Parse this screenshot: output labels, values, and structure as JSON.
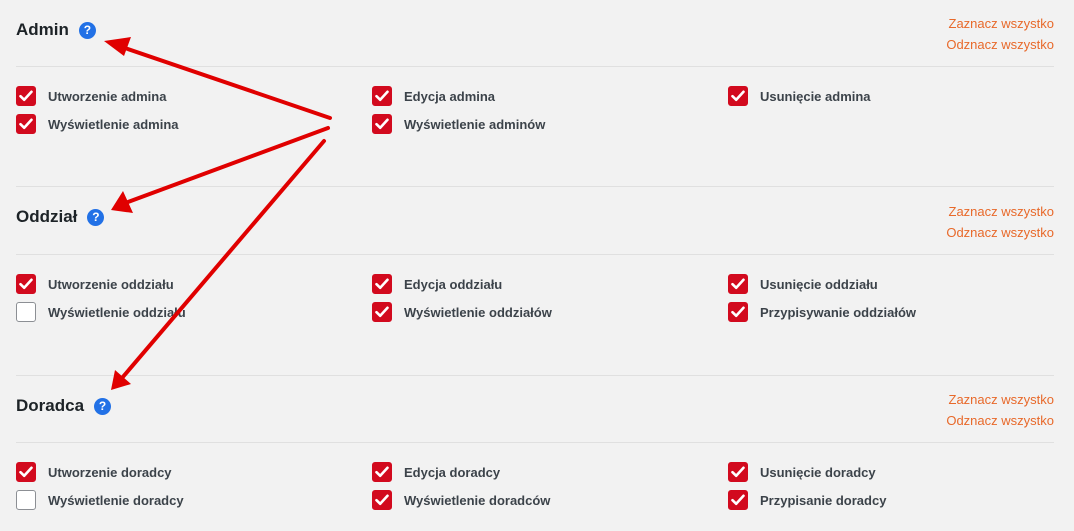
{
  "sections": [
    {
      "title": "Admin",
      "help": "?",
      "select_all": "Zaznacz wszystko",
      "deselect_all": "Odznacz wszystko",
      "rows": [
        [
          {
            "label": "Utworzenie admina",
            "checked": true
          },
          {
            "label": "Edycja admina",
            "checked": true
          },
          {
            "label": "Usunięcie admina",
            "checked": true
          }
        ],
        [
          {
            "label": "Wyświetlenie admina",
            "checked": true
          },
          {
            "label": "Wyświetlenie adminów",
            "checked": true
          }
        ]
      ]
    },
    {
      "title": "Oddział",
      "help": "?",
      "select_all": "Zaznacz wszystko",
      "deselect_all": "Odznacz wszystko",
      "rows": [
        [
          {
            "label": "Utworzenie oddziału",
            "checked": true
          },
          {
            "label": "Edycja oddziału",
            "checked": true
          },
          {
            "label": "Usunięcie oddziału",
            "checked": true
          }
        ],
        [
          {
            "label": "Wyświetlenie oddziału",
            "checked": false
          },
          {
            "label": "Wyświetlenie oddziałów",
            "checked": true
          },
          {
            "label": "Przypisywanie oddziałów",
            "checked": true
          }
        ]
      ]
    },
    {
      "title": "Doradca",
      "help": "?",
      "select_all": "Zaznacz wszystko",
      "deselect_all": "Odznacz wszystko",
      "rows": [
        [
          {
            "label": "Utworzenie doradcy",
            "checked": true
          },
          {
            "label": "Edycja doradcy",
            "checked": true
          },
          {
            "label": "Usunięcie doradcy",
            "checked": true
          }
        ],
        [
          {
            "label": "Wyświetlenie doradcy",
            "checked": false
          },
          {
            "label": "Wyświetlenie doradców",
            "checked": true
          },
          {
            "label": "Przypisanie doradcy",
            "checked": true
          }
        ]
      ]
    }
  ],
  "colors": {
    "accent_link": "#e8692a",
    "checkbox_checked": "#d20a1e",
    "help_icon": "#2271e6",
    "annotation_arrow": "#e00000"
  },
  "icons": {
    "help": "question-circle-icon",
    "check": "checkmark-icon"
  }
}
